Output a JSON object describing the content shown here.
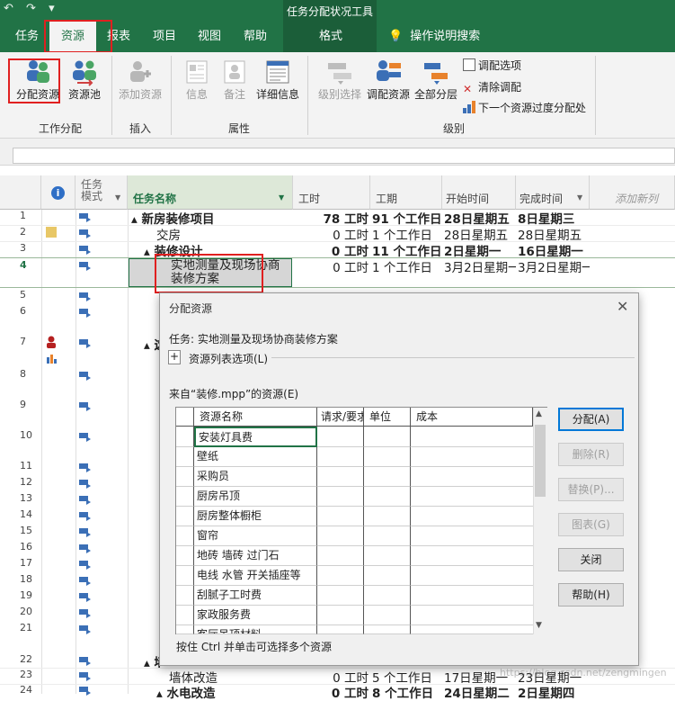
{
  "qat": {
    "undo": "↶",
    "redo": "↷",
    "customize": "▾"
  },
  "window": {
    "context_title": "任务分配状况工具"
  },
  "tabs": {
    "task": "任务",
    "resource": "资源",
    "report": "报表",
    "project": "项目",
    "view": "视图",
    "help": "帮助",
    "format": "格式",
    "tell_me": "操作说明搜索"
  },
  "ribbon": {
    "assign_resources": "分配资源",
    "resource_pool": "资源池",
    "group_assignments": "工作分配",
    "add_resource": "添加资源",
    "group_insert": "插入",
    "information": "信息",
    "notes": "备注",
    "details": "详细信息",
    "group_properties": "属性",
    "level_selection": "级别选择",
    "level_resource": "调配资源",
    "level_all": "全部分层",
    "leveling_options": "调配选项",
    "clear_leveling": "清除调配",
    "next_overallocation": "下一个资源过度分配处",
    "group_level": "级别"
  },
  "grid": {
    "headers": {
      "task_mode": "任务\n模式",
      "task_name": "任务名称",
      "work": "工时",
      "duration": "工期",
      "start": "开始时间",
      "finish": "完成时间",
      "add_column": "添加新列"
    },
    "rows": [
      {
        "num": "1",
        "name": "▴ 新房装修项目",
        "work": "78 工时",
        "duration": "91 个工作日",
        "start": "28日星期五",
        "finish": "8日星期三"
      },
      {
        "num": "2",
        "name": "交房",
        "work": "0 工时",
        "duration": "1 个工作日",
        "start": "28日星期五",
        "finish": "28日星期五"
      },
      {
        "num": "3",
        "name": "▴ 装修设计",
        "work": "0 工时",
        "duration": "11 个工作日",
        "start": "2日星期一",
        "finish": "16日星期一"
      },
      {
        "num": "4",
        "name": "实地测量及现场协商装修方案",
        "work": "0 工时",
        "duration": "1 个工作日",
        "start": "3月2日星期一",
        "finish": "3月2日星期一"
      },
      {
        "num": "5",
        "name": "",
        "work": "",
        "duration": "",
        "start": "",
        "finish": ""
      },
      {
        "num": "6",
        "name": "",
        "work": "",
        "duration": "",
        "start": "",
        "finish": ""
      },
      {
        "num": "7",
        "name": "▴ 这",
        "work": "",
        "duration": "",
        "start": "",
        "finish": ""
      },
      {
        "num": "8"
      },
      {
        "num": "9"
      },
      {
        "num": "10"
      },
      {
        "num": "11"
      },
      {
        "num": "12"
      },
      {
        "num": "13"
      },
      {
        "num": "14"
      },
      {
        "num": "15"
      },
      {
        "num": "16"
      },
      {
        "num": "17"
      },
      {
        "num": "18"
      },
      {
        "num": "19"
      },
      {
        "num": "20"
      },
      {
        "num": "21"
      },
      {
        "num": "22",
        "name": "▴ 墙"
      },
      {
        "num": "23",
        "name": "墙体改造",
        "work": "0 工时",
        "duration": "5 个工作日",
        "start": "17日星期一",
        "finish": "23日星期一"
      },
      {
        "num": "24",
        "name": "▴ 水电改造",
        "work": "0 工时",
        "duration": "8 个工作日",
        "start": "24日星期二",
        "finish": "2日星期四"
      }
    ]
  },
  "dialog": {
    "title": "分配资源",
    "task_label": "任务: 实地测量及现场协商装修方案",
    "expander": "+",
    "list_options": "资源列表选项(L)",
    "source_label": "来自“装修.mpp”的资源(E)",
    "columns": {
      "name": "资源名称",
      "request": "请求/要求",
      "units": "单位",
      "cost": "成本"
    },
    "resources": [
      "安装灯具费",
      "壁纸",
      "采购员",
      "厨房吊顶",
      "厨房整体橱柜",
      "窗帘",
      "地砖 墙砖 过门石",
      "电线 水管 开关插座等",
      "刮腻子工时费",
      "家政服务费",
      "客厅吊顶材料"
    ],
    "buttons": {
      "assign": "分配(A)",
      "remove": "删除(R)",
      "replace": "替换(P)...",
      "graph": "图表(G)",
      "close": "关闭",
      "help": "帮助(H)"
    },
    "hint": "按住 Ctrl 并单击可选择多个资源",
    "close_glyph": "✕"
  },
  "watermark": "https://blog.csdn.net/zengmingen"
}
